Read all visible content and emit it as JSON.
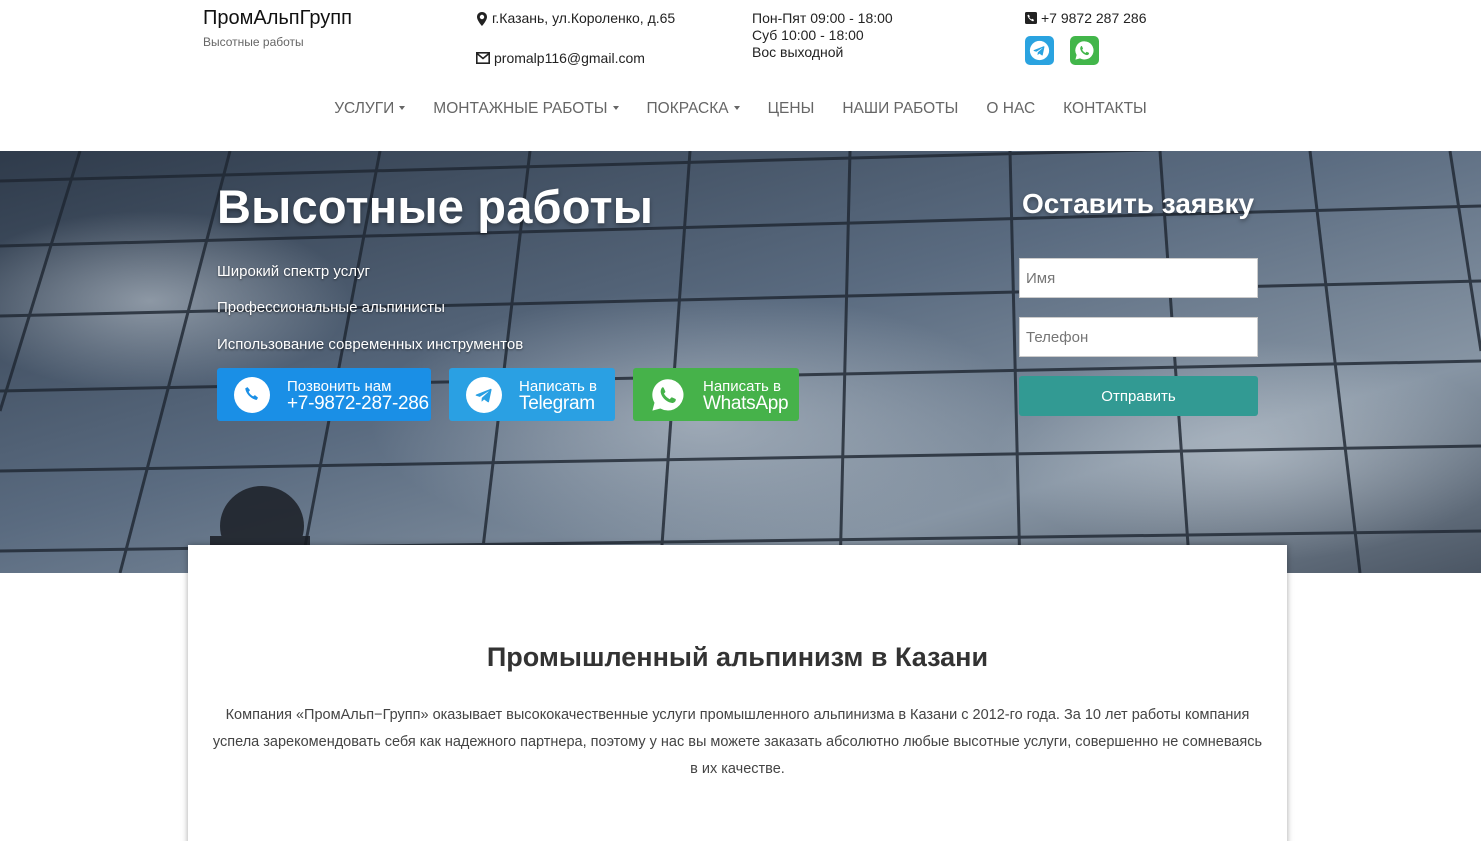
{
  "header": {
    "brand_name": "ПромАльпГрупп",
    "brand_tagline": "Высотные работы",
    "address": "г.Казань, ул.Короленко, д.65",
    "email": "promalp116@gmail.com",
    "hours": [
      "Пон-Пят 09:00 - 18:00",
      "Суб 10:00 - 18:00",
      "Вос выходной"
    ],
    "phone": "+7 9872 287 286",
    "icons": {
      "address": "map-marker-icon",
      "email": "envelope-icon",
      "phone": "phone-square-icon",
      "telegram": "telegram-icon",
      "whatsapp": "whatsapp-icon"
    }
  },
  "nav": {
    "items": [
      {
        "label": "УСЛУГИ",
        "dropdown": true
      },
      {
        "label": "МОНТАЖНЫЕ РАБОТЫ",
        "dropdown": true
      },
      {
        "label": "ПОКРАСКА",
        "dropdown": true
      },
      {
        "label": "ЦЕНЫ",
        "dropdown": false
      },
      {
        "label": "НАШИ РАБОТЫ",
        "dropdown": false
      },
      {
        "label": "О НАС",
        "dropdown": false
      },
      {
        "label": "КОНТАКТЫ",
        "dropdown": false
      }
    ]
  },
  "hero": {
    "title": "Высотные работы",
    "points": [
      "Широкий спектр услуг",
      "Профессиональные альпинисты",
      "Использование современных инструментов"
    ],
    "buttons": {
      "call": {
        "line1": "Позвонить нам",
        "line2": "+7-9872-287-286"
      },
      "telegram": {
        "line1": "Написать в",
        "line2": "Telegram"
      },
      "whatsapp": {
        "line1": "Написать в",
        "line2": "WhatsApp"
      }
    }
  },
  "form": {
    "title": "Оставить заявку",
    "name_placeholder": "Имя",
    "phone_placeholder": "Телефон",
    "submit_label": "Отправить"
  },
  "content": {
    "title": "Промышленный альпинизм в Казани",
    "text": "Компания «ПромАльп−Групп» оказывает высококачественные услуги промышленного альпинизма в Казани с 2012-го года. За 10 лет работы компания успела зарекомендовать себя как надежного партнера, поэтому у нас вы можете заказать абсолютно любые высотные услуги, совершенно не сомневаясь в их качестве."
  },
  "colors": {
    "call_button": "#1a8fe6",
    "telegram": "#2aa3e0",
    "whatsapp": "#42b64a",
    "submit": "#329a93"
  }
}
